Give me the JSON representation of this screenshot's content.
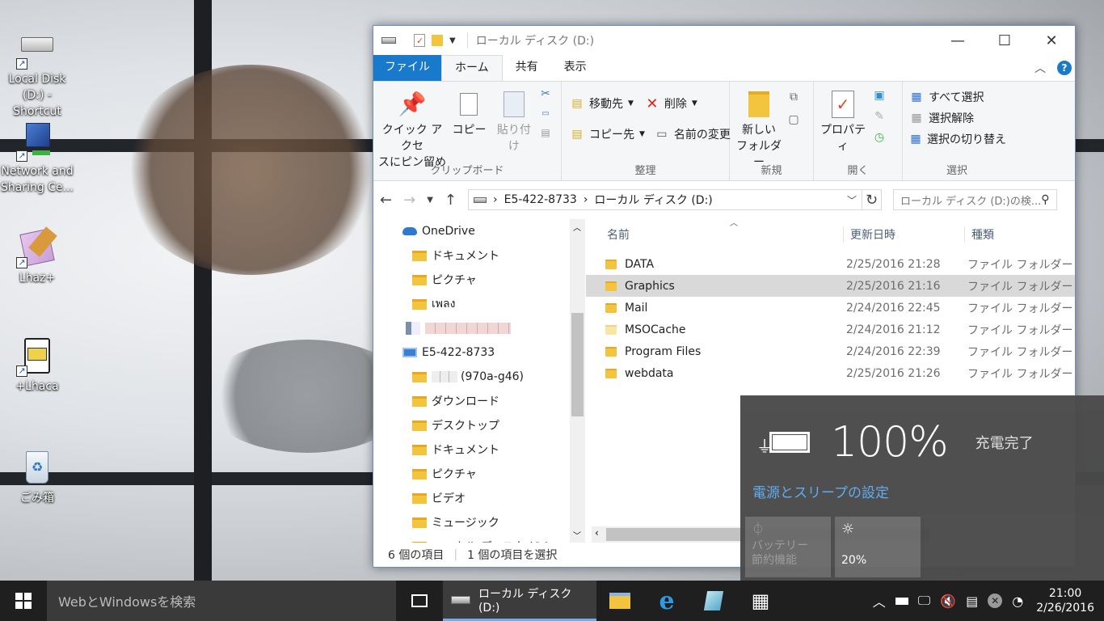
{
  "desktop": {
    "icons": [
      {
        "label_line1": "Local Disk",
        "label_line2": "(D:) - Shortcut",
        "icon": "drive-icon"
      },
      {
        "label_line1": "Network and",
        "label_line2": "Sharing Ce...",
        "icon": "network-icon"
      },
      {
        "label_line1": "Lhaz+",
        "label_line2": "",
        "icon": "lhaz-icon"
      },
      {
        "label_line1": "+Lhaca",
        "label_line2": "",
        "icon": "lhaca-icon"
      },
      {
        "label_line1": "ごみ箱",
        "label_line2": "",
        "icon": "recycle-bin-icon"
      }
    ]
  },
  "window": {
    "title": "ローカル ディスク (D:)",
    "tabs": [
      "ファイル",
      "ホーム",
      "共有",
      "表示"
    ],
    "ribbon": {
      "clipboard": {
        "label": "クリップボード",
        "pin": "クイック アクセ",
        "pin2": "スにピン留め",
        "copy": "コピー",
        "paste": "貼り付け"
      },
      "organize": {
        "label": "整理",
        "move_to": "移動先",
        "copy_to": "コピー先",
        "delete": "削除",
        "rename": "名前の変更"
      },
      "new": {
        "label": "新規",
        "new_folder1": "新しい",
        "new_folder2": "フォルダー"
      },
      "open": {
        "label": "開く",
        "properties": "プロパティ"
      },
      "select": {
        "label": "選択",
        "select_all": "すべて選択",
        "select_none": "選択解除",
        "invert": "選択の切り替え"
      }
    },
    "address": {
      "pc": "E5-422-8733",
      "location": "ローカル ディスク (D:)",
      "search_placeholder": "ローカル ディスク (D:)の検..."
    },
    "nav": [
      {
        "label": "OneDrive",
        "indent": 0
      },
      {
        "label": "ドキュメント",
        "indent": 1
      },
      {
        "label": "ピクチャ",
        "indent": 1
      },
      {
        "label": "เพลง",
        "indent": 1
      },
      {
        "label": "",
        "indent": 0
      },
      {
        "label": "E5-422-8733",
        "indent": 0
      },
      {
        "label": "(970a-g46)",
        "indent": 1
      },
      {
        "label": "ダウンロード",
        "indent": 1
      },
      {
        "label": "デスクトップ",
        "indent": 1
      },
      {
        "label": "ドキュメント",
        "indent": 1
      },
      {
        "label": "ピクチャ",
        "indent": 1
      },
      {
        "label": "ビデオ",
        "indent": 1
      },
      {
        "label": "ミュージック",
        "indent": 1
      },
      {
        "label": "ローカル ディスク (C:)",
        "indent": 1
      }
    ],
    "columns": {
      "name": "名前",
      "date": "更新日時",
      "type": "種類"
    },
    "files": [
      {
        "name": "DATA",
        "date": "2/25/2016 21:28",
        "type": "ファイル フォルダー"
      },
      {
        "name": "Graphics",
        "date": "2/25/2016 21:16",
        "type": "ファイル フォルダー"
      },
      {
        "name": "Mail",
        "date": "2/24/2016 22:45",
        "type": "ファイル フォルダー"
      },
      {
        "name": "MSOCache",
        "date": "2/24/2016 21:12",
        "type": "ファイル フォルダー"
      },
      {
        "name": "Program Files",
        "date": "2/24/2016 22:39",
        "type": "ファイル フォルダー"
      },
      {
        "name": "webdata",
        "date": "2/25/2016 21:26",
        "type": "ファイル フォルダー"
      }
    ],
    "status": {
      "count": "6 個の項目",
      "selected": "1 個の項目を選択"
    }
  },
  "battery": {
    "percent": "100%",
    "state": "充電完了",
    "settings_link": "電源とスリープの設定",
    "saver_line1": "バッテリー",
    "saver_line2": "節約機能",
    "brightness": "20%"
  },
  "taskbar": {
    "search_placeholder": "WebとWindowsを検索",
    "active_app": "ローカル ディスク (D:)",
    "time": "21:00",
    "date": "2/26/2016"
  }
}
